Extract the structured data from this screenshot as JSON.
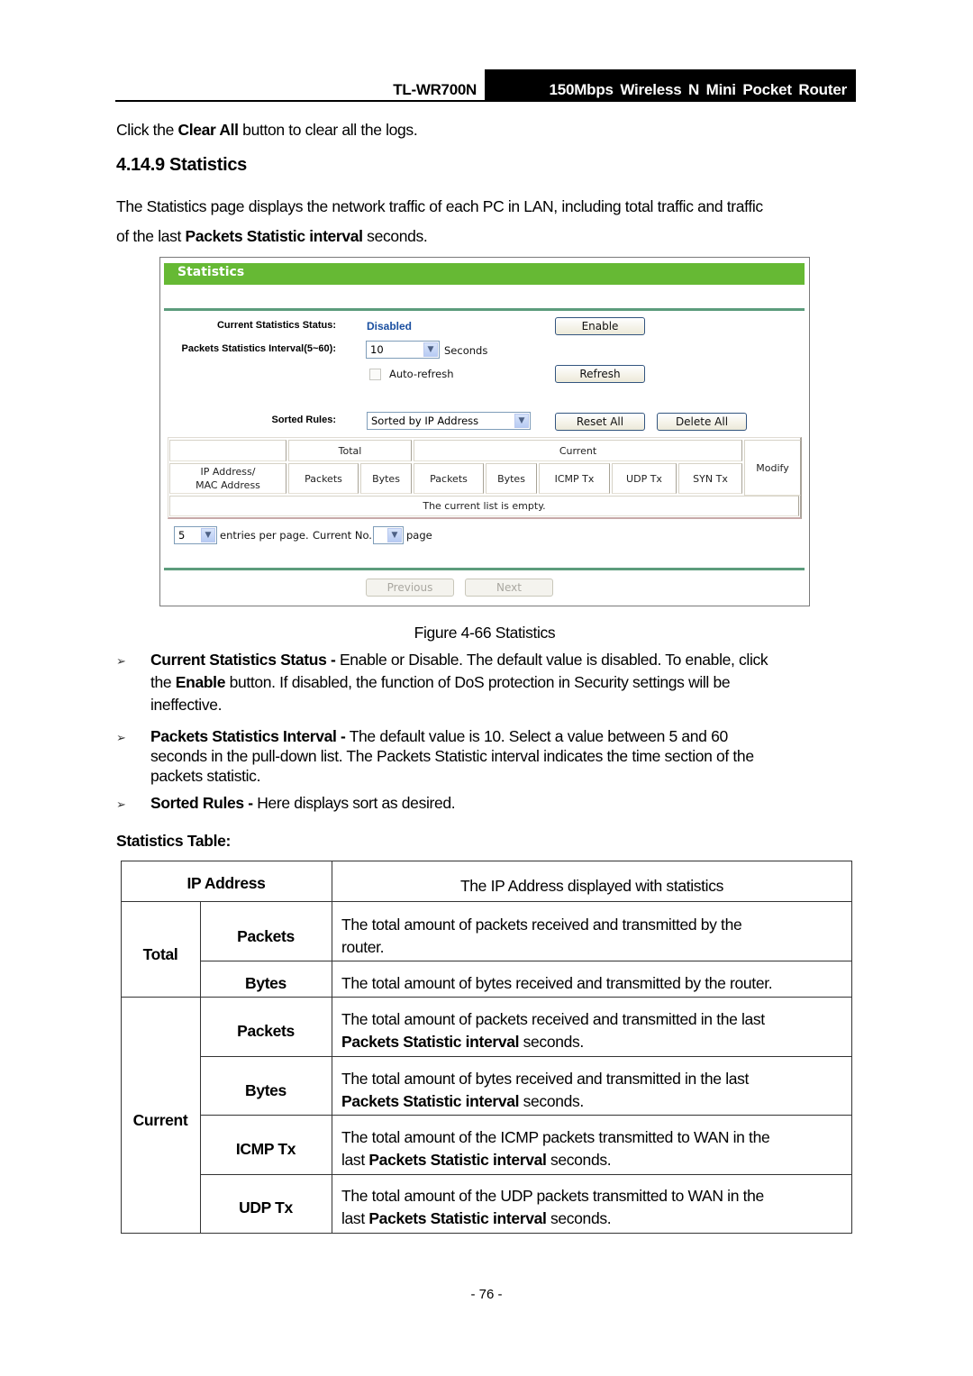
{
  "running_header": {
    "model": "TL-WR700N",
    "product": "150Mbps Wireless N Mini Pocket Router"
  },
  "intro_line": {
    "before": "Click the ",
    "bold": "Clear All",
    "after": " button to clear all the logs."
  },
  "section_title": "4.14.9 Statistics",
  "section_desc": {
    "line1": "The Statistics page displays the network traffic of each PC in LAN, including total traffic and traffic",
    "line2_before": "of the last ",
    "line2_bold": "Packets Statistic interval",
    "line2_after": " seconds."
  },
  "router_ui": {
    "title": "Statistics",
    "status_label": "Current Statistics Status:",
    "status_value": "Disabled",
    "status_color": "#1a4fa0",
    "interval_label": "Packets Statistics Interval(5~60):",
    "interval_value": "10",
    "interval_unit": "Seconds",
    "autorefresh_label": "Auto-refresh",
    "autorefresh_checked": false,
    "sorted_label": "Sorted Rules:",
    "sorted_value": "Sorted by IP Address",
    "buttons": {
      "enable": "Enable",
      "refresh": "Refresh",
      "reset_all": "Reset All",
      "delete_all": "Delete All",
      "previous": "Previous",
      "next": "Next"
    },
    "table": {
      "group_total": "Total",
      "group_current": "Current",
      "ip_mac_line1": "IP Address/",
      "ip_mac_line2": "MAC Address",
      "columns": [
        "Packets",
        "Bytes",
        "Packets",
        "Bytes",
        "ICMP Tx",
        "UDP Tx",
        "SYN Tx"
      ],
      "modify": "Modify",
      "empty_message": "The current list is empty."
    },
    "pagination": {
      "entries_value": "5",
      "entries_label": "entries per page.",
      "current_no_label": "Current No.",
      "current_no_value": "",
      "page_label": "page"
    },
    "header_color": "#66b934"
  },
  "figure_caption": "Figure 4-66 Statistics",
  "bullets": [
    {
      "bold": "Current Statistics Status -",
      "l1": " Enable or Disable. The default value is disabled. To enable, click",
      "l2_before": "the ",
      "l2_bold": "Enable",
      "l2_after": " button. If disabled, the function of DoS protection in Security settings will be",
      "l3": "ineffective."
    },
    {
      "bold": "Packets Statistics Interval -",
      "l1": " The default value is 10. Select a value between 5 and 60",
      "l2": "seconds in the pull-down list. The Packets Statistic interval indicates the time section of the",
      "l3": "packets statistic."
    },
    {
      "bold": "Sorted Rules -",
      "l1": " Here displays sort as desired."
    }
  ],
  "table_heading": "Statistics Table:",
  "stats_table": {
    "ip_header": "IP Address",
    "ip_desc": "The IP Address displayed with statistics",
    "group_total": "Total",
    "group_current": "Current",
    "rows": [
      {
        "name": "Packets",
        "l1": "The total amount of packets received and transmitted by the",
        "l2": "router."
      },
      {
        "name": "Bytes",
        "l1": "The total amount of bytes received and transmitted by the router."
      },
      {
        "name": "Packets",
        "l1": "The total amount of packets received and transmitted in the last",
        "l2_bold": "Packets Statistic interval",
        "l2_after": " seconds."
      },
      {
        "name": "Bytes",
        "l1": "The total amount of bytes received and transmitted in the last",
        "l2_bold": "Packets Statistic interval",
        "l2_after": " seconds."
      },
      {
        "name": "ICMP Tx",
        "l1": "The total amount of the ICMP packets transmitted to WAN in the",
        "l2_before": "last ",
        "l2_bold": "Packets Statistic interval",
        "l2_after": " seconds."
      },
      {
        "name": "UDP Tx",
        "l1": "The total amount of the UDP packets transmitted to WAN in the",
        "l2_before": "last ",
        "l2_bold": "Packets Statistic interval",
        "l2_after": " seconds."
      }
    ]
  },
  "page_number": "- 76 -"
}
